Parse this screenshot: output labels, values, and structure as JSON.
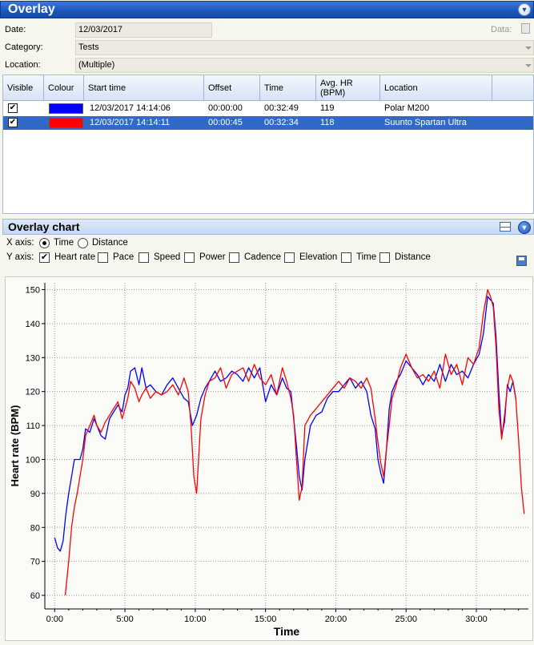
{
  "overlay": {
    "title": "Overlay",
    "date_label": "Date:",
    "date_value": "12/03/2017",
    "data_label": "Data:",
    "category_label": "Category:",
    "category_value": "Tests",
    "location_label": "Location:",
    "location_value": "(Multiple)"
  },
  "grid": {
    "columns": [
      "Visible",
      "Colour",
      "Start time",
      "Offset",
      "Time",
      "Avg. HR\n(BPM)",
      "Location"
    ],
    "rows": [
      {
        "visible": "✔",
        "colour": "#0000ff",
        "start_time": "12/03/2017 14:14:06",
        "offset": "00:00:00",
        "time": "00:32:49",
        "avg_hr": "119",
        "location": "Polar M200"
      },
      {
        "visible": "✔",
        "colour": "#ff0000",
        "start_time": "12/03/2017 14:14:11",
        "offset": "00:00:45",
        "time": "00:32:34",
        "avg_hr": "118",
        "location": "Suunto Spartan Ultra"
      }
    ]
  },
  "overlay_chart": {
    "title": "Overlay chart",
    "x_axis_label": "X axis:",
    "x_options": [
      "Time",
      "Distance"
    ],
    "x_selected": "Time",
    "y_axis_label": "Y axis:",
    "y_options": [
      "Heart rate",
      "Pace",
      "Speed",
      "Power",
      "Cadence",
      "Elevation",
      "Time",
      "Distance"
    ],
    "y_checked": [
      "Heart rate"
    ]
  },
  "chart_data": {
    "type": "line",
    "xlabel": "Time",
    "ylabel": "Heart rate (BPM)",
    "x_unit": "minutes",
    "xlim": [
      -0.7,
      33.7
    ],
    "ylim": [
      56,
      152
    ],
    "xticks": [
      "0:00",
      "5:00",
      "10:00",
      "15:00",
      "20:00",
      "25:00",
      "30:00"
    ],
    "yticks": [
      60,
      70,
      80,
      90,
      100,
      110,
      120,
      130,
      140,
      150
    ],
    "grid": true,
    "series": [
      {
        "color": "#0000ff",
        "x": [
          0,
          0.2,
          0.4,
          0.6,
          0.8,
          1.0,
          1.2,
          1.4,
          1.6,
          1.8,
          2.0,
          2.2,
          2.5,
          2.8,
          3.0,
          3.3,
          3.6,
          3.9,
          4.2,
          4.5,
          4.8,
          5.0,
          5.2,
          5.4,
          5.7,
          6.0,
          6.2,
          6.5,
          6.8,
          7.2,
          7.6,
          8.0,
          8.4,
          8.8,
          9.2,
          9.5,
          9.8,
          10.1,
          10.4,
          10.7,
          11.0,
          11.4,
          11.8,
          12.2,
          12.6,
          13.0,
          13.4,
          13.8,
          14.2,
          14.6,
          15.0,
          15.4,
          15.8,
          16.2,
          16.5,
          16.8,
          17.0,
          17.2,
          17.4,
          17.6,
          17.8,
          18.2,
          18.6,
          19.0,
          19.4,
          19.8,
          20.2,
          20.6,
          21.0,
          21.4,
          21.8,
          22.2,
          22.5,
          22.8,
          23.0,
          23.2,
          23.4,
          23.6,
          23.8,
          24.0,
          24.3,
          24.6,
          25.0,
          25.4,
          25.8,
          26.2,
          26.6,
          27.0,
          27.4,
          27.8,
          28.2,
          28.6,
          29.0,
          29.4,
          29.8,
          30.2,
          30.5,
          30.8,
          31.0,
          31.2,
          31.4,
          31.6,
          31.8,
          32.0,
          32.2,
          32.4,
          32.6,
          32.8
        ],
        "y": [
          77,
          74,
          73,
          76,
          84,
          90,
          95,
          100,
          100,
          100,
          103,
          109,
          108,
          112,
          110,
          107,
          106,
          112,
          114,
          116,
          114,
          119,
          121,
          126,
          127,
          122,
          127,
          121,
          122,
          120,
          119,
          122,
          124,
          121,
          118,
          117,
          110,
          113,
          118,
          121,
          123,
          126,
          123,
          124,
          126,
          125,
          123,
          127,
          124,
          127,
          117,
          122,
          119,
          124,
          121,
          120,
          112,
          104,
          95,
          91,
          100,
          110,
          113,
          114,
          118,
          120,
          120,
          122,
          124,
          121,
          123,
          120,
          113,
          109,
          100,
          96,
          93,
          103,
          115,
          120,
          123,
          125,
          129,
          127,
          125,
          122,
          125,
          123,
          128,
          123,
          128,
          125,
          126,
          124,
          128,
          131,
          137,
          148,
          147,
          146,
          136,
          120,
          107,
          111,
          122,
          120,
          123,
          118
        ]
      },
      {
        "color": "#ff0000",
        "x": [
          0.75,
          0.9,
          1.0,
          1.2,
          1.4,
          1.6,
          1.8,
          2.0,
          2.2,
          2.5,
          2.8,
          3.0,
          3.3,
          3.6,
          3.9,
          4.2,
          4.5,
          4.8,
          5.0,
          5.2,
          5.4,
          5.7,
          6.0,
          6.2,
          6.5,
          6.8,
          7.2,
          7.6,
          8.0,
          8.4,
          8.8,
          9.2,
          9.5,
          9.7,
          9.9,
          10.1,
          10.4,
          10.7,
          11.0,
          11.4,
          11.8,
          12.2,
          12.6,
          13.0,
          13.4,
          13.8,
          14.2,
          14.6,
          15.0,
          15.4,
          15.8,
          16.2,
          16.5,
          16.8,
          17.0,
          17.2,
          17.4,
          17.6,
          17.8,
          18.2,
          18.6,
          19.0,
          19.4,
          19.8,
          20.2,
          20.6,
          21.0,
          21.4,
          21.8,
          22.2,
          22.5,
          22.8,
          23.0,
          23.2,
          23.4,
          23.6,
          23.8,
          24.0,
          24.3,
          24.6,
          25.0,
          25.4,
          25.8,
          26.2,
          26.6,
          27.0,
          27.4,
          27.8,
          28.2,
          28.6,
          29.0,
          29.4,
          29.8,
          30.2,
          30.5,
          30.8,
          31.0,
          31.2,
          31.4,
          31.6,
          31.8,
          32.0,
          32.2,
          32.4,
          32.6,
          32.8,
          33.0,
          33.2,
          33.4
        ],
        "y": [
          60,
          66,
          70,
          80,
          86,
          90,
          95,
          100,
          107,
          110,
          113,
          110,
          108,
          111,
          113,
          115,
          117,
          112,
          115,
          118,
          123,
          121,
          117,
          119,
          121,
          118,
          120,
          119,
          120,
          122,
          119,
          124,
          120,
          110,
          95,
          90,
          112,
          119,
          123,
          124,
          127,
          121,
          125,
          126,
          127,
          123,
          128,
          124,
          122,
          125,
          119,
          127,
          123,
          118,
          113,
          100,
          88,
          92,
          110,
          113,
          115,
          117,
          119,
          121,
          123,
          121,
          124,
          123,
          121,
          124,
          121,
          112,
          105,
          99,
          95,
          103,
          110,
          118,
          122,
          127,
          131,
          127,
          124,
          125,
          123,
          126,
          121,
          131,
          125,
          128,
          122,
          130,
          128,
          133,
          143,
          150,
          148,
          145,
          133,
          115,
          106,
          113,
          121,
          125,
          123,
          118,
          106,
          92,
          84
        ]
      }
    ]
  }
}
